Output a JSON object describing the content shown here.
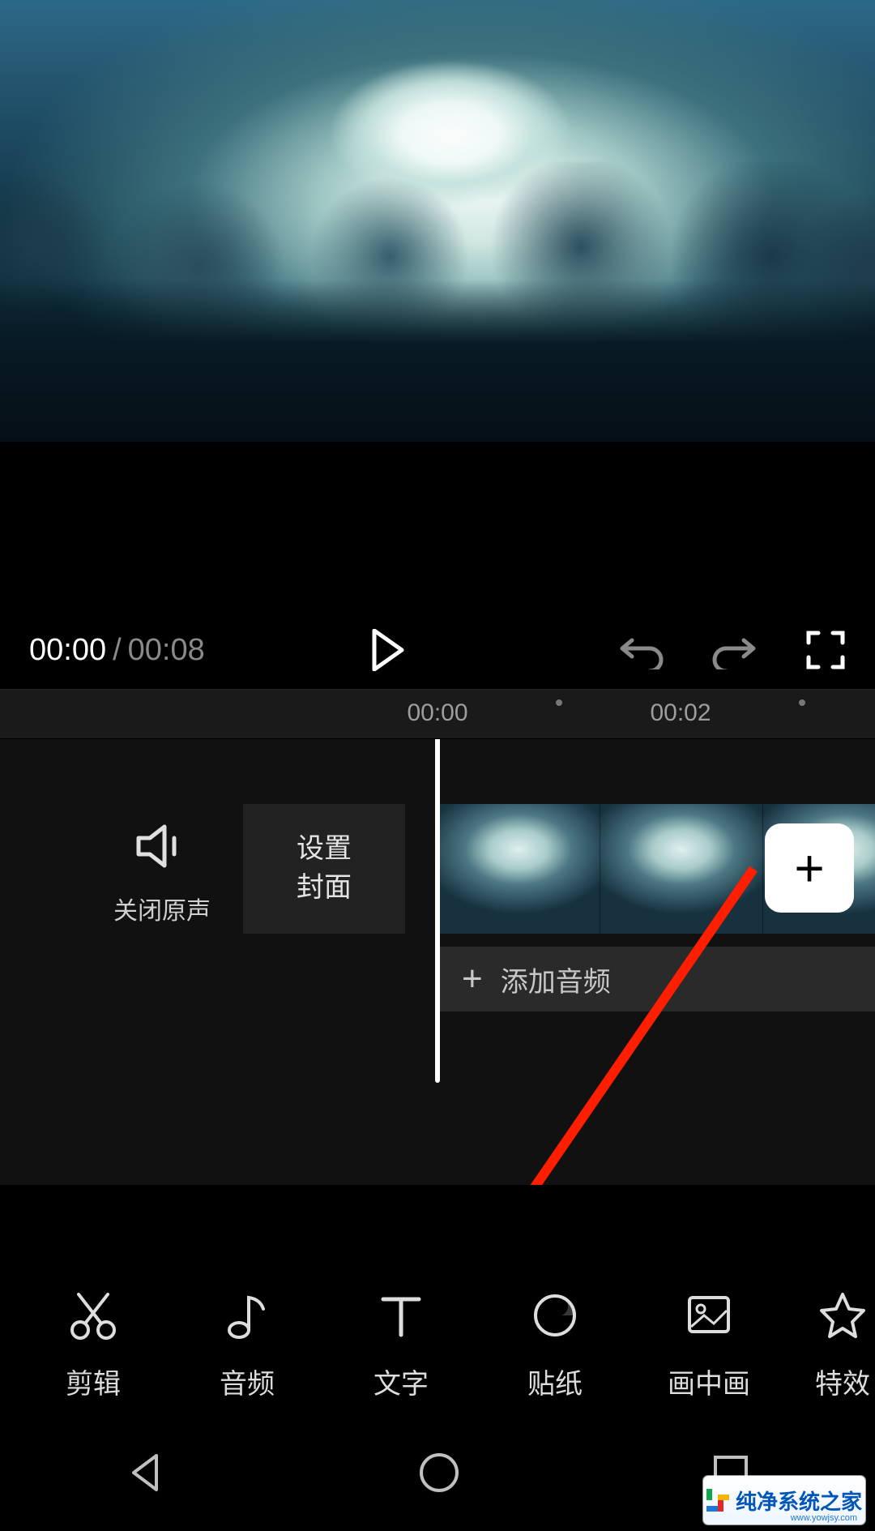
{
  "playback": {
    "current": "00:00",
    "separator": " / ",
    "total": "00:08"
  },
  "ruler": {
    "tick0": "00:00",
    "tick1": "00:02"
  },
  "timeline": {
    "mute_label": "关闭原声",
    "cover_label": "设置\n封面",
    "add_audio_label": "添加音频",
    "add_clip_symbol": "+"
  },
  "toolbar": {
    "cut": "剪辑",
    "audio": "音频",
    "text": "文字",
    "sticker": "贴纸",
    "pip": "画中画",
    "effect": "特效"
  },
  "watermark": {
    "brand": "纯净系统之家",
    "url": "www.yowjsy.com"
  }
}
